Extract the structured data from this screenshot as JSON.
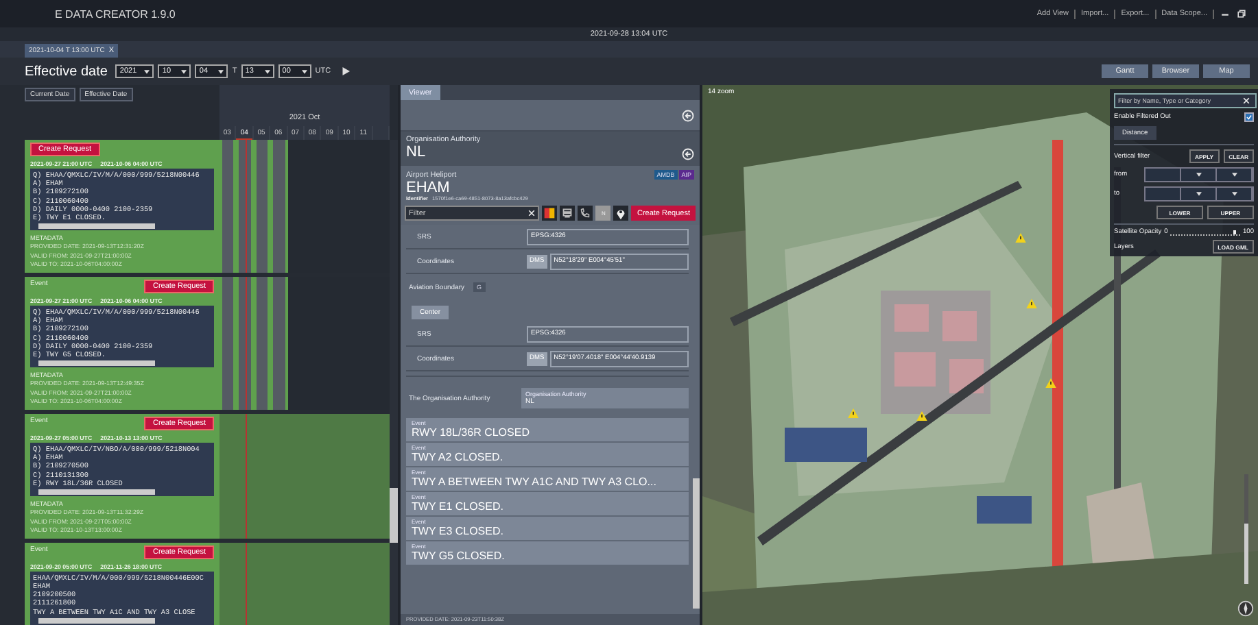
{
  "app": {
    "title": "E DATA CREATOR 1.9.0",
    "menu": [
      "Add View",
      "Import...",
      "Export...",
      "Data Scope..."
    ]
  },
  "clock": "2021-09-28 13:04 UTC",
  "doc_tabs": [
    {
      "label": "2021-10-04 T 13:00 UTC",
      "close": "X",
      "selected": true
    }
  ],
  "effective_date": {
    "label": "Effective date",
    "year": "2021",
    "month": "10",
    "day": "04",
    "sep": "T",
    "hour": "13",
    "minute": "00",
    "zone": "UTC"
  },
  "views": [
    "Gantt",
    "Browser",
    "Map"
  ],
  "gantt": {
    "buttons": [
      "Current Date",
      "Effective Date"
    ],
    "month": "2021 Oct",
    "days": [
      {
        "label": "03",
        "current": false
      },
      {
        "label": "04",
        "current": true
      },
      {
        "label": "05",
        "current": false
      },
      {
        "label": "06",
        "current": false
      },
      {
        "label": "07",
        "current": false
      },
      {
        "label": "08",
        "current": false
      },
      {
        "label": "09",
        "current": false
      },
      {
        "label": "10",
        "current": false
      },
      {
        "label": "11",
        "current": false
      }
    ],
    "events": [
      {
        "button": "Create Request",
        "start": "2021-09-27 21:00 UTC",
        "end": "2021-10-06 04:00 UTC",
        "notam": [
          "Q) EHAA/QMXLC/IV/M/A/000/999/5218N00446",
          "A) EHAM",
          "B) 2109272100",
          "C) 2110060400",
          "D) DAILY 0000-0400 2100-2359",
          "E) TWY E1 CLOSED."
        ],
        "metadata_title": "METADATA",
        "metadata": [
          "PROVIDED DATE: 2021-09-13T12:31:20Z",
          "VALID FROM: 2021-09-27T21:00:00Z",
          "VALID TO: 2021-10-06T04:00:00Z"
        ],
        "kind": "partial"
      },
      {
        "label": "Event",
        "button": "Create Request",
        "start": "2021-09-27 21:00 UTC",
        "end": "2021-10-06 04:00 UTC",
        "notam": [
          "Q) EHAA/QMXLC/IV/M/A/000/999/5218N00446",
          "A) EHAM",
          "B) 2109272100",
          "C) 2110060400",
          "D) DAILY 0000-0400 2100-2359",
          "E) TWY G5 CLOSED."
        ],
        "metadata_title": "METADATA",
        "metadata": [
          "PROVIDED DATE: 2021-09-13T12:49:35Z",
          "VALID FROM: 2021-09-27T21:00:00Z",
          "VALID TO: 2021-10-06T04:00:00Z"
        ],
        "kind": "partial"
      },
      {
        "label": "Event",
        "button": "Create Request",
        "start": "2021-09-27 05:00 UTC",
        "end": "2021-10-13 13:00 UTC",
        "notam": [
          "Q) EHAA/QMXLC/IV/NBO/A/000/999/5218N004",
          "A) EHAM",
          "B) 2109270500",
          "C) 2110131300",
          "E) RWY 18L/36R CLOSED"
        ],
        "metadata_title": "METADATA",
        "metadata": [
          "PROVIDED DATE: 2021-09-13T11:32:29Z",
          "VALID FROM: 2021-09-27T05:00:00Z",
          "VALID TO: 2021-10-13T13:00:00Z"
        ],
        "kind": "full"
      },
      {
        "label": "Event",
        "button": "Create Request",
        "start": "2021-09-20 05:00 UTC",
        "end": "2021-11-26 18:00 UTC",
        "notam": [
          "EHAA/QMXLC/IV/M/A/000/999/5218N00446E00C",
          "EHAM",
          "2109200500",
          "2111261800",
          "TWY A BETWEEN TWY A1C AND TWY A3 CLOSE"
        ],
        "kind": "full"
      }
    ]
  },
  "viewer": {
    "tab": "Viewer",
    "org": {
      "label": "Organisation Authority",
      "value": "NL"
    },
    "airport": {
      "label": "Airport Heliport",
      "name": "EHAM",
      "badges": [
        {
          "text": "AMDB",
          "color": "#1f5a8c"
        },
        {
          "text": "AIP",
          "color": "#5b2a8e"
        }
      ],
      "identifier_label": "Identifier",
      "identifier": "1570f1e6-ca69-4851-8073-8a13afcbc429"
    },
    "filter": {
      "placeholder": "Filter"
    },
    "n_button": "N",
    "create_button": "Create Request",
    "rows": [
      {
        "kind": "field",
        "label": "SRS",
        "value": "EPSG:4326"
      },
      {
        "kind": "coord",
        "label": "Coordinates",
        "format": "DMS",
        "value": "N52°18'29\" E004°45'51\""
      },
      {
        "kind": "section",
        "label": "Aviation Boundary",
        "badge": "G"
      },
      {
        "kind": "button",
        "label": "Center"
      },
      {
        "kind": "field",
        "label": "SRS",
        "value": "EPSG:4326"
      },
      {
        "kind": "coord",
        "label": "Coordinates",
        "format": "DMS",
        "value": "N52°19'07.4018\" E004°44'40.9139"
      },
      {
        "kind": "ref",
        "label": "The Organisation Authority",
        "title": "Organisation Authority",
        "value": "NL"
      }
    ],
    "events": [
      {
        "label": "Event",
        "title": "RWY 18L/36R CLOSED"
      },
      {
        "label": "Event",
        "title": "TWY A2 CLOSED."
      },
      {
        "label": "Event",
        "title": "TWY A BETWEEN TWY A1C AND TWY A3 CLO..."
      },
      {
        "label": "Event",
        "title": "TWY E1 CLOSED."
      },
      {
        "label": "Event",
        "title": "TWY E3 CLOSED."
      },
      {
        "label": "Event",
        "title": "TWY G5 CLOSED."
      }
    ],
    "footer": "PROVIDED DATE: 2021-09-23T11:50:38Z"
  },
  "map": {
    "zoom_label": "14 zoom",
    "zoom_slider": {
      "level": 0.55
    },
    "panel": {
      "filter_placeholder": "Filter by Name, Type or Category",
      "enable_label": "Enable Filtered Out",
      "enable_checked": true,
      "distance": "Distance",
      "vertical_label": "Vertical filter",
      "apply": "APPLY",
      "clear": "CLEAR",
      "from": "from",
      "to": "to",
      "lower": "LOWER",
      "upper": "UPPER",
      "opacity_label": "Satellite Opacity",
      "opacity_min": "0",
      "opacity_max": "100",
      "opacity": {
        "level": 0.95
      },
      "layers": "Layers",
      "load": "LOAD GML"
    }
  }
}
